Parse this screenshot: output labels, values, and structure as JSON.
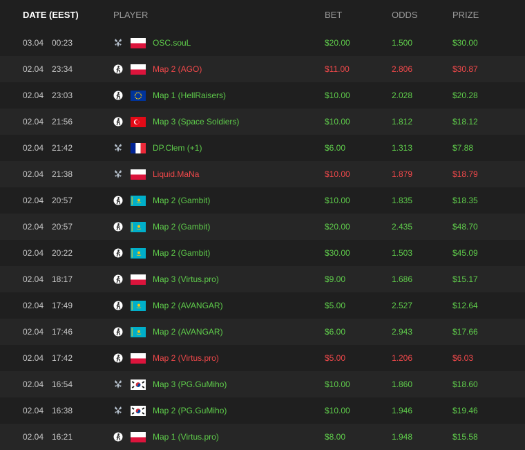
{
  "header": {
    "date": "DATE (EEST)",
    "player": "PLAYER",
    "bet": "BET",
    "odds": "ODDS",
    "prize": "PRIZE"
  },
  "colors": {
    "win": "#5fcd4b",
    "loss": "#f0484a",
    "background": "#1f1f1f",
    "row_alt": "#262626"
  },
  "rows": [
    {
      "date": "03.04",
      "time": "00:23",
      "game": "starcraft-icon",
      "flag": "poland",
      "player": "OSC.souL",
      "bet": "$20.00",
      "odds": "1.500",
      "prize": "$30.00",
      "result": "win"
    },
    {
      "date": "02.04",
      "time": "23:34",
      "game": "csgo-icon",
      "flag": "poland",
      "player": "Map 2 (AGO)",
      "bet": "$11.00",
      "odds": "2.806",
      "prize": "$30.87",
      "result": "loss"
    },
    {
      "date": "02.04",
      "time": "23:03",
      "game": "csgo-icon",
      "flag": "eu",
      "player": "Map 1 (HellRaisers)",
      "bet": "$10.00",
      "odds": "2.028",
      "prize": "$20.28",
      "result": "win"
    },
    {
      "date": "02.04",
      "time": "21:56",
      "game": "csgo-icon",
      "flag": "turkey",
      "player": "Map 3 (Space Soldiers)",
      "bet": "$10.00",
      "odds": "1.812",
      "prize": "$18.12",
      "result": "win"
    },
    {
      "date": "02.04",
      "time": "21:42",
      "game": "starcraft-icon",
      "flag": "france",
      "player": "DP.Clem (+1)",
      "bet": "$6.00",
      "odds": "1.313",
      "prize": "$7.88",
      "result": "win"
    },
    {
      "date": "02.04",
      "time": "21:38",
      "game": "starcraft-icon",
      "flag": "poland",
      "player": "Liquid.MaNa",
      "bet": "$10.00",
      "odds": "1.879",
      "prize": "$18.79",
      "result": "loss"
    },
    {
      "date": "02.04",
      "time": "20:57",
      "game": "csgo-icon",
      "flag": "kazakhstan",
      "player": "Map 2 (Gambit)",
      "bet": "$10.00",
      "odds": "1.835",
      "prize": "$18.35",
      "result": "win"
    },
    {
      "date": "02.04",
      "time": "20:57",
      "game": "csgo-icon",
      "flag": "kazakhstan",
      "player": "Map 2 (Gambit)",
      "bet": "$20.00",
      "odds": "2.435",
      "prize": "$48.70",
      "result": "win"
    },
    {
      "date": "02.04",
      "time": "20:22",
      "game": "csgo-icon",
      "flag": "kazakhstan",
      "player": "Map 2 (Gambit)",
      "bet": "$30.00",
      "odds": "1.503",
      "prize": "$45.09",
      "result": "win"
    },
    {
      "date": "02.04",
      "time": "18:17",
      "game": "csgo-icon",
      "flag": "poland",
      "player": "Map 3 (Virtus.pro)",
      "bet": "$9.00",
      "odds": "1.686",
      "prize": "$15.17",
      "result": "win"
    },
    {
      "date": "02.04",
      "time": "17:49",
      "game": "csgo-icon",
      "flag": "kazakhstan",
      "player": "Map 2 (AVANGAR)",
      "bet": "$5.00",
      "odds": "2.527",
      "prize": "$12.64",
      "result": "win"
    },
    {
      "date": "02.04",
      "time": "17:46",
      "game": "csgo-icon",
      "flag": "kazakhstan",
      "player": "Map 2 (AVANGAR)",
      "bet": "$6.00",
      "odds": "2.943",
      "prize": "$17.66",
      "result": "win"
    },
    {
      "date": "02.04",
      "time": "17:42",
      "game": "csgo-icon",
      "flag": "poland",
      "player": "Map 2 (Virtus.pro)",
      "bet": "$5.00",
      "odds": "1.206",
      "prize": "$6.03",
      "result": "loss"
    },
    {
      "date": "02.04",
      "time": "16:54",
      "game": "starcraft-icon",
      "flag": "south-korea",
      "player": "Map 3 (PG.GuMiho)",
      "bet": "$10.00",
      "odds": "1.860",
      "prize": "$18.60",
      "result": "win"
    },
    {
      "date": "02.04",
      "time": "16:38",
      "game": "starcraft-icon",
      "flag": "south-korea",
      "player": "Map 2 (PG.GuMiho)",
      "bet": "$10.00",
      "odds": "1.946",
      "prize": "$19.46",
      "result": "win"
    },
    {
      "date": "02.04",
      "time": "16:21",
      "game": "csgo-icon",
      "flag": "poland",
      "player": "Map 1 (Virtus.pro)",
      "bet": "$8.00",
      "odds": "1.948",
      "prize": "$15.58",
      "result": "win"
    }
  ]
}
